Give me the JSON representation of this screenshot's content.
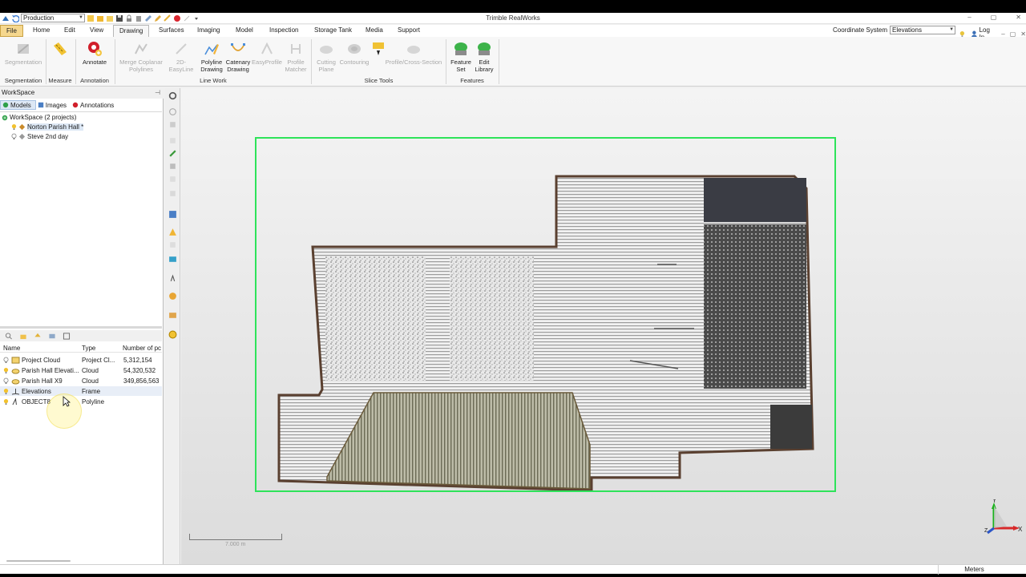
{
  "window": {
    "title": "Trimble RealWorks",
    "mode": "Production"
  },
  "menu": {
    "tabs": [
      "File",
      "Home",
      "Edit",
      "View",
      "Drawing",
      "Surfaces",
      "Imaging",
      "Model",
      "Inspection",
      "Storage Tank",
      "Media",
      "Support"
    ],
    "active_tab": "Drawing",
    "coordinate_system_label": "Coordinate System",
    "coordinate_system_value": "Elevations",
    "login": "Log In"
  },
  "ribbon": {
    "segmentation": {
      "button": "Segmentation",
      "group": "Segmentation"
    },
    "measure": {
      "group": "Measure"
    },
    "annotation": {
      "button": "Annotate",
      "group": "Annotation"
    },
    "line_work": {
      "group": "Line Work",
      "merge_l1": "Merge Coplanar",
      "merge_l2": "Polylines",
      "easyline": "2D-EasyLine",
      "polyline_l1": "Polyline",
      "polyline_l2": "Drawing",
      "catenary_l1": "Catenary",
      "catenary_l2": "Drawing",
      "easyprofile": "EasyProfile",
      "profile_l1": "Profile",
      "profile_l2": "Matcher"
    },
    "slice_tools": {
      "group": "Slice Tools",
      "cutting_l1": "Cutting",
      "cutting_l2": "Plane",
      "contouring": "Contouring",
      "profile_cross": "Profile/Cross-Section"
    },
    "features": {
      "group": "Features",
      "feature_l1": "Feature",
      "feature_l2": "Set",
      "edit_l1": "Edit",
      "edit_l2": "Library"
    }
  },
  "workspace": {
    "title": "WorkSpace",
    "tabs": [
      "Models",
      "Images",
      "Annotations"
    ],
    "root": "WorkSpace  (2 projects)",
    "projects": [
      "Norton Parish Hall  *",
      "Steve 2nd day"
    ]
  },
  "table": {
    "headers": [
      "Name",
      "Type",
      "Number of pc"
    ],
    "rows": [
      {
        "name": "Project Cloud",
        "type": "Project Cl...",
        "count": "5,312,154"
      },
      {
        "name": "Parish Hall Elevati...",
        "type": "Cloud",
        "count": "54,320,532"
      },
      {
        "name": "Parish Hall X9",
        "type": "Cloud",
        "count": "349,856,563"
      },
      {
        "name": "Elevations",
        "type": "Frame",
        "count": ""
      },
      {
        "name": "OBJECT8",
        "type": "Polyline",
        "count": ""
      }
    ]
  },
  "viewport": {
    "scale_label": "7.000 m",
    "axis_x": "X",
    "axis_y": "Y",
    "axis_z": "Z"
  },
  "status": {
    "units": "Meters"
  },
  "colors": {
    "frame": "#2ee35a",
    "file_tab": "#f5d78e"
  }
}
